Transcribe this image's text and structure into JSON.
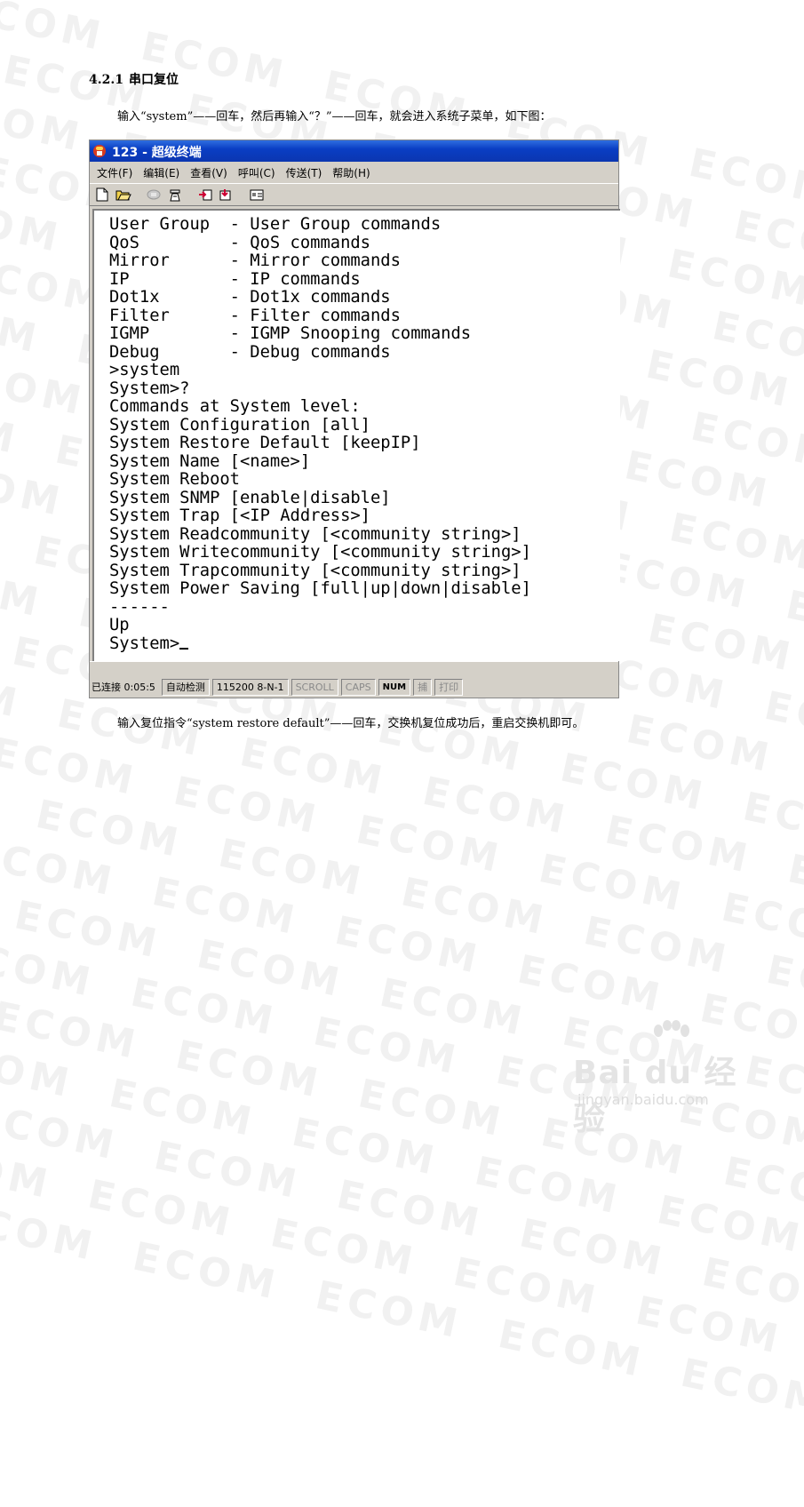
{
  "watermark": {
    "text": "ECOM"
  },
  "section": {
    "number": "4.2.1",
    "title": "串口复位"
  },
  "intro_text": "输入“system”——回车，然后再输入“？”——回车，就会进入系统子菜单，如下图：",
  "closing_text": "输入复位指令“system restore default”——回车，交换机复位成功后，重启交换机即可。",
  "window": {
    "title": "123 - 超级终端",
    "menu": [
      "文件(F)",
      "编辑(E)",
      "查看(V)",
      "呼叫(C)",
      "传送(T)",
      "帮助(H)"
    ],
    "toolbar_icons": [
      "new-icon",
      "open-icon",
      "disconnect-icon",
      "call-icon",
      "send-icon",
      "receive-icon",
      "properties-icon"
    ],
    "terminal_lines": [
      "User Group  - User Group commands",
      "QoS         - QoS commands",
      "Mirror      - Mirror commands",
      "IP          - IP commands",
      "Dot1x       - Dot1x commands",
      "Filter      - Filter commands",
      "IGMP        - IGMP Snooping commands",
      "Debug       - Debug commands",
      ">system",
      "System>?",
      "Commands at System level:",
      "System Configuration [all]",
      "System Restore Default [keepIP]",
      "System Name [<name>]",
      "System Reboot",
      "System SNMP [enable|disable]",
      "System Trap [<IP Address>]",
      "System Readcommunity [<community string>]",
      "System Writecommunity [<community string>]",
      "System Trapcommunity [<community string>]",
      "System Power Saving [full|up|down|disable]",
      "------",
      "Up"
    ],
    "prompt": "System>",
    "status": {
      "connected": "已连接 0:05:5",
      "detect": "自动检测",
      "baud": "115200 8-N-1",
      "scroll": "SCROLL",
      "caps": "CAPS",
      "num": "NUM",
      "capture": "捕",
      "print": "打印"
    }
  },
  "logo": {
    "main": "Bai du 经验",
    "sub": "jingyan.baidu.com"
  },
  "colors": {
    "titlebar": "#0a3ec4",
    "window_face": "#d4d0c8",
    "terminal_bg": "#ffffff"
  }
}
